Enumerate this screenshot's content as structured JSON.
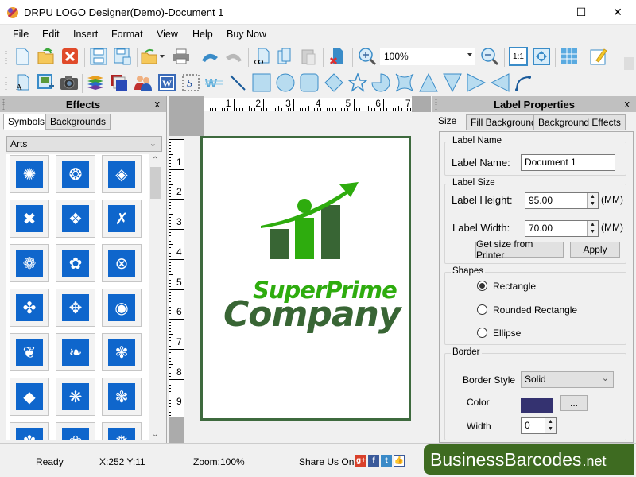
{
  "window": {
    "title": "DRPU LOGO Designer(Demo)-Document 1",
    "minimize": "—",
    "maximize": "☐",
    "close": "✕"
  },
  "menu": [
    "File",
    "Edit",
    "Insert",
    "Format",
    "View",
    "Help",
    "Buy Now"
  ],
  "toolbar": {
    "zoom_value": "100%",
    "one_to_one": "1:1"
  },
  "effects": {
    "title": "Effects",
    "close": "x",
    "tabs": [
      "Symbols",
      "Backgrounds"
    ],
    "active_tab": "Symbols",
    "category": "Arts",
    "symbols": [
      "triskele",
      "knot-circle",
      "spiral-diamond",
      "cross-knot",
      "diamond-knot",
      "x-knot",
      "ring-knot",
      "loop-knot",
      "x-circle",
      "quad-circle",
      "swirl-squares",
      "ring-square",
      "lotus-circle",
      "swirl-frame",
      "leaf-x",
      "diamond-leaf",
      "fan",
      "leaf-plant",
      "flower-bottom",
      "flower-two",
      "swirl-bottom"
    ]
  },
  "ruler": {
    "h_ticks": [
      "1",
      "2",
      "3",
      "4",
      "5",
      "6",
      "7"
    ],
    "v_ticks": [
      "1",
      "2",
      "3",
      "4",
      "5",
      "6",
      "7",
      "8",
      "9"
    ]
  },
  "logo": {
    "line1": "SuperPrime",
    "line2": "Company",
    "color_light": "#2eac0e",
    "color_dark": "#386534"
  },
  "properties": {
    "title": "Label Properties",
    "close": "x",
    "tabs": [
      "Size",
      "Fill Background",
      "Background Effects"
    ],
    "active_tab": "Size",
    "label_name_group": "Label Name",
    "label_name_label": "Label Name:",
    "label_name_value": "Document 1",
    "label_size_group": "Label Size",
    "height_label": "Label Height:",
    "height_value": "95.00",
    "width_label": "Label Width:",
    "width_value": "70.00",
    "unit": "(MM)",
    "get_size_button": "Get size from Printer",
    "apply_button": "Apply",
    "shapes_group": "Shapes",
    "shapes": [
      "Rectangle",
      "Rounded Rectangle",
      "Ellipse"
    ],
    "selected_shape": "Rectangle",
    "border_group": "Border",
    "border_style_label": "Border Style",
    "border_style_value": "Solid",
    "color_label": "Color",
    "color_value": "#343270",
    "color_button": "...",
    "width_field_label": "Width",
    "border_width_value": "0"
  },
  "status": {
    "state": "Ready",
    "coords": "X:252  Y:11",
    "zoom": "Zoom:100%",
    "share": "Share Us On:",
    "social": [
      "g+",
      "f",
      "t",
      "like"
    ]
  },
  "brand": {
    "name": "BusinessBarcodes",
    "tld": ".net"
  }
}
